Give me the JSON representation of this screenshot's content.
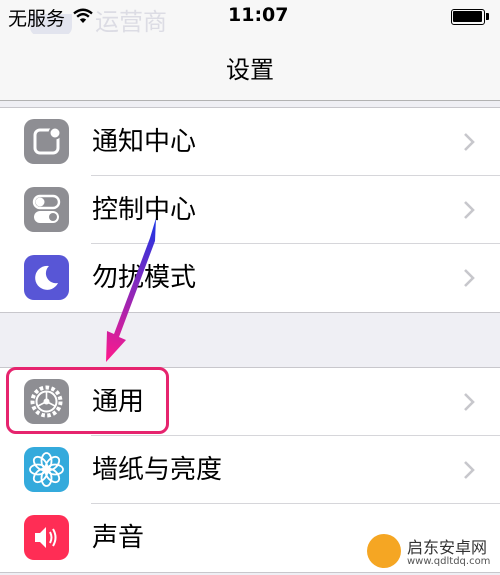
{
  "status_bar": {
    "carrier": "无服务",
    "time": "11:07",
    "partial_text": "运营商"
  },
  "nav": {
    "title": "设置"
  },
  "groups": [
    {
      "items": [
        {
          "label": "通知中心",
          "icon": "notification-center-icon",
          "color": "#8e8e93"
        },
        {
          "label": "控制中心",
          "icon": "control-center-icon",
          "color": "#8e8e93"
        },
        {
          "label": "勿扰模式",
          "icon": "moon-icon",
          "color": "#5856d6"
        }
      ]
    },
    {
      "items": [
        {
          "label": "通用",
          "icon": "gear-icon",
          "color": "#8e8e93"
        },
        {
          "label": "墙纸与亮度",
          "icon": "wallpaper-flower-icon",
          "color": "#34aadc"
        },
        {
          "label": "声音",
          "icon": "speaker-icon",
          "color": "#ff2d55"
        }
      ]
    }
  ],
  "annotation": {
    "highlight_color": "#e6246e",
    "arrow_color_start": "#1a35e6",
    "arrow_color_end": "#ff1a8c"
  },
  "watermark": {
    "text": "启东安卓网",
    "url": "www.qdltdq.com"
  }
}
